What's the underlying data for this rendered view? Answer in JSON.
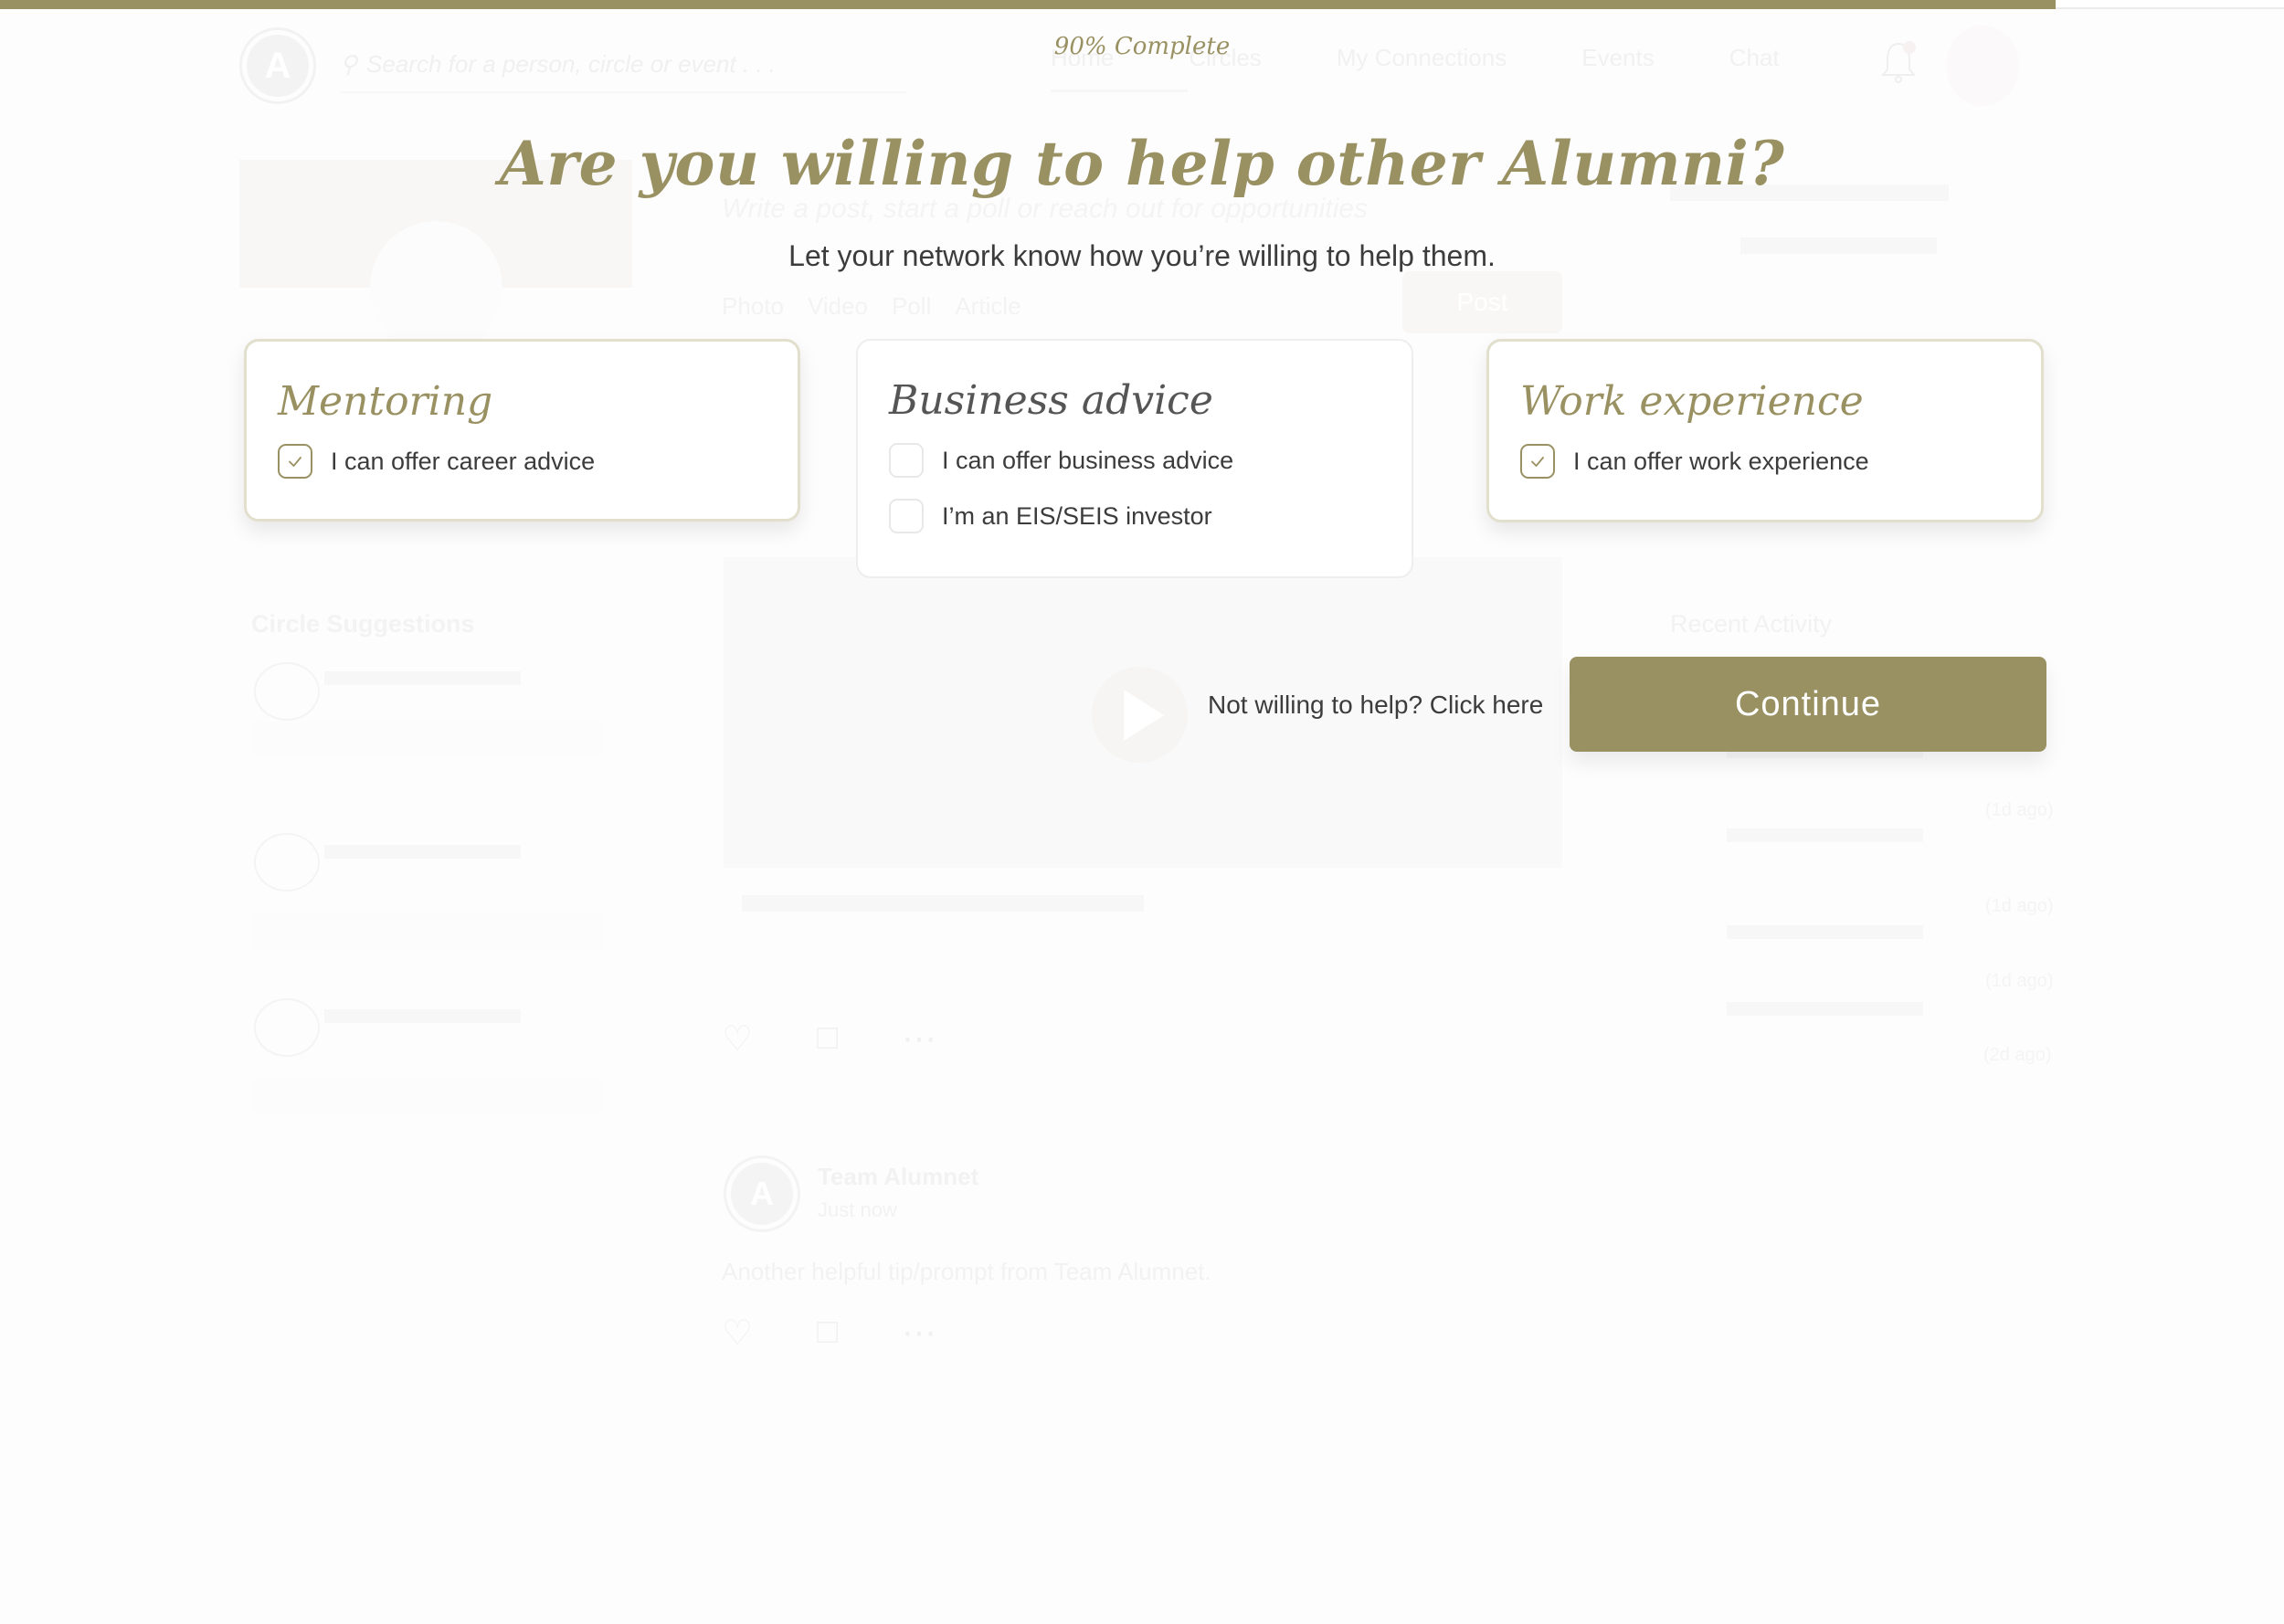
{
  "progress": {
    "percent": 90,
    "label": "90% Complete"
  },
  "colors": {
    "accent": "#9a9163",
    "text": "#3c3c3c",
    "muted_heading": "#555555"
  },
  "modal": {
    "title": "Are you willing to help other Alumni?",
    "subtitle": "Let your network know how you’re willing to help them.",
    "cards": [
      {
        "title": "Mentoring",
        "selected": true,
        "options": [
          {
            "label": "I can offer career advice",
            "checked": true
          }
        ]
      },
      {
        "title": "Business advice",
        "selected": false,
        "options": [
          {
            "label": "I can offer business advice",
            "checked": false
          },
          {
            "label": "I’m an EIS/SEIS investor",
            "checked": false
          }
        ]
      },
      {
        "title": "Work experience",
        "selected": true,
        "options": [
          {
            "label": "I can offer work experience",
            "checked": true
          }
        ]
      }
    ],
    "skip_link": "Not willing to help? Click here",
    "continue_label": "Continue"
  },
  "background": {
    "logo_letter": "A",
    "search_placeholder": "Search for a person, circle or event . . .",
    "nav": [
      "Home",
      "Circles",
      "My Connections",
      "Events",
      "Chat"
    ],
    "composer_placeholder": "Write a post, start a poll or reach out for opportunities",
    "composer_tools": [
      "Photo",
      "Video",
      "Poll",
      "Article"
    ],
    "post_button": "Post",
    "circle_suggestions_title": "Circle Suggestions",
    "recent_activity_title": "Recent Activity",
    "recent_activity_times": [
      "(1d ago)",
      "(1d ago)",
      "(1d ago)",
      "(2d ago)"
    ],
    "team_post": {
      "author": "Team Alumnet",
      "time": "Just now",
      "text": "Another helpful tip/prompt from Team Alumnet."
    }
  }
}
